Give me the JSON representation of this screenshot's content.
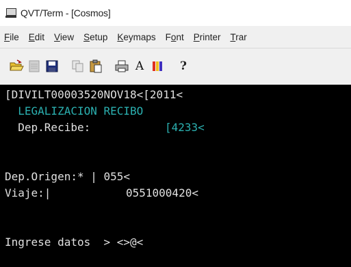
{
  "window": {
    "title": "QVT/Term - [Cosmos]",
    "icon": "terminal-monitor-icon"
  },
  "menu": [
    {
      "pre": "",
      "key": "F",
      "post": "ile"
    },
    {
      "pre": "",
      "key": "E",
      "post": "dit"
    },
    {
      "pre": "",
      "key": "V",
      "post": "iew"
    },
    {
      "pre": "",
      "key": "S",
      "post": "etup"
    },
    {
      "pre": "",
      "key": "K",
      "post": "eymaps"
    },
    {
      "pre": "F",
      "key": "o",
      "post": "nt"
    },
    {
      "pre": "",
      "key": "P",
      "post": "rinter"
    },
    {
      "pre": "",
      "key": "T",
      "post": "rar"
    }
  ],
  "toolbar": [
    {
      "name": "open-folder-icon"
    },
    {
      "name": "disabled-page-icon"
    },
    {
      "name": "save-disk-icon"
    },
    {
      "name": "copy-icon"
    },
    {
      "name": "paste-icon"
    },
    {
      "name": "print-icon"
    },
    {
      "name": "font-icon",
      "label": "A"
    },
    {
      "name": "colors-icon"
    },
    {
      "name": "help-icon",
      "label": "?"
    }
  ],
  "colors": {
    "terminal_bg": "#000000",
    "terminal_text": "#e0e0e0",
    "terminal_highlight": "#2bb0b0"
  },
  "terminal": {
    "line1": "[DIVILT00003520NOV18<[2011<",
    "line2": "  LEGALIZACION RECIBO",
    "line3_label": "  Dep.Recibe:",
    "line3_value": "[4233<",
    "line5": "Dep.Origen:* | 055<",
    "line6_label": "Viaje:|",
    "line6_value": "0551000420<",
    "line8": "Ingrese datos  > <>@<"
  }
}
